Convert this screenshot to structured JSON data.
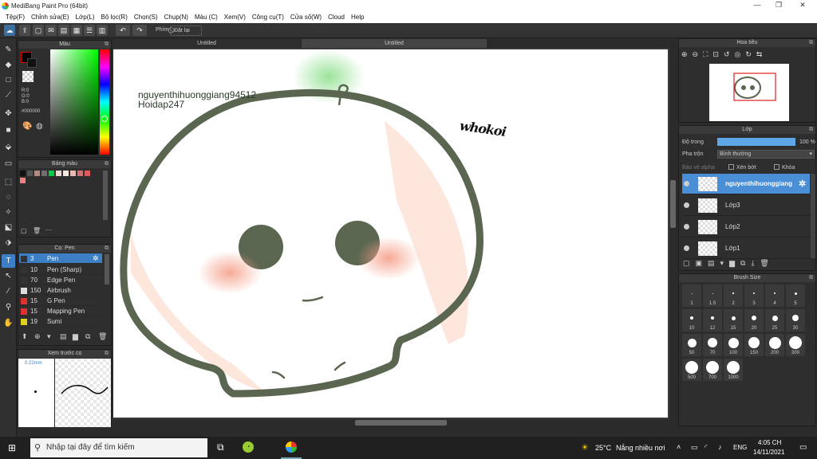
{
  "window": {
    "title": "MediBang Paint Pro (64bit)",
    "minimize": "—",
    "maximize": "❐",
    "close": "✕"
  },
  "menu": [
    "Tệp(F)",
    "Chỉnh sửa(E)",
    "Lớp(L)",
    "Bộ lọc(R)",
    "Chọn(S)",
    "Chụp(N)",
    "Màu (C)",
    "Xem(V)",
    "Công cụ(T)",
    "Cửa số(W)",
    "Cloud",
    "Help"
  ],
  "toolbar": {
    "phim_label": "Phím",
    "reset_label": "Đặt lại"
  },
  "color_panel": {
    "title": "Màu",
    "r": "R:0",
    "g": "G:0",
    "b": "B:0",
    "hex": "#000000"
  },
  "palette_panel": {
    "title": "Bảng màu",
    "swatches": [
      "#111111",
      "#555555",
      "#b48a80",
      "#6e6e6e",
      "#00cc44",
      "#e9d9d0",
      "#f5e9e0",
      "#e8b9b0",
      "#d07070",
      "#e05a5a",
      "#f08080"
    ],
    "footer_text": "----"
  },
  "brush_panel": {
    "title": "Cọ: Pen",
    "items": [
      {
        "size": "3",
        "name": "Pen",
        "color": "#333333"
      },
      {
        "size": "10",
        "name": "Pen (Sharp)",
        "color": "#333333"
      },
      {
        "size": "70",
        "name": "Edge Pen",
        "color": "#333333"
      },
      {
        "size": "150",
        "name": "Airbrush",
        "color": "#dddddd"
      },
      {
        "size": "15",
        "name": "G Pen",
        "color": "#e03030"
      },
      {
        "size": "15",
        "name": "Mapping Pen",
        "color": "#e03030"
      },
      {
        "size": "19",
        "name": "Sumi",
        "color": "#e0d020"
      }
    ]
  },
  "preview_panel": {
    "title": "Xem trước cọ",
    "size": "0.22mm"
  },
  "tabs": [
    "Untitled",
    "Untitled"
  ],
  "canvas_text": {
    "username": "nguyenthihuonggiang94512",
    "site": "Hoidap247",
    "scribble": "whokoi"
  },
  "nav_panel": {
    "title": "Hoa tiêu"
  },
  "layer_panel": {
    "title": "Lớp",
    "opacity_label": "Độ trong",
    "opacity_value": "100 %",
    "blend_label": "Pha trộn",
    "blend_value": "Bình thường",
    "protect_alpha": "Bảo vệ alpha",
    "clipping": "Xén bớt",
    "lock": "Khóa",
    "layers": [
      "nguyenthihuonggiang",
      "Lớp3",
      "Lớp2",
      "Lớp1"
    ]
  },
  "brushsize_panel": {
    "title": "Brush Size",
    "sizes": [
      "1",
      "1.5",
      "2",
      "3",
      "4",
      "5",
      "10",
      "12",
      "15",
      "20",
      "25",
      "30",
      "50",
      "70",
      "100",
      "150",
      "200",
      "300",
      "500",
      "700",
      "1000"
    ]
  },
  "taskbar": {
    "search_placeholder": "Nhập tại đây để tìm kiếm",
    "temperature": "25°C",
    "weather": "Nắng nhiều nơi",
    "language": "ENG",
    "time": "4:05 CH",
    "date": "14/11/2021"
  },
  "colors": {
    "accent": "#3d7fc4",
    "stroke": "#5a6650",
    "blush": "#f5a08a"
  }
}
